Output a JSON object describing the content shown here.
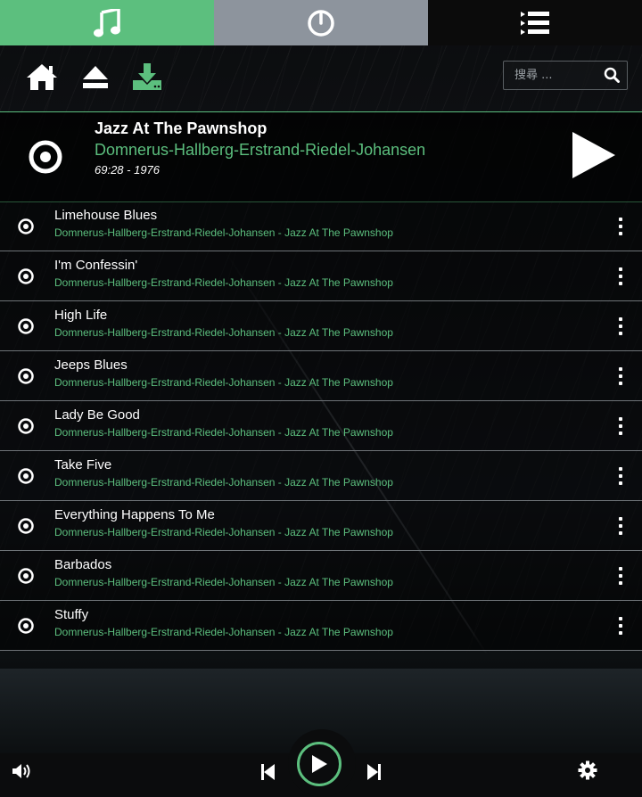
{
  "tabs": [
    {
      "name": "music-note-icon",
      "active": true
    },
    {
      "name": "clock-icon",
      "active": false
    },
    {
      "name": "playlist-icon",
      "active": false
    }
  ],
  "toolbar": {
    "home": "home-icon",
    "eject": "eject-icon",
    "download": "download-icon"
  },
  "search": {
    "placeholder": "搜尋 ..."
  },
  "album": {
    "title": "Jazz At The Pawnshop",
    "artist": "Domnerus-Hallberg-Erstrand-Riedel-Johansen",
    "meta": "69:28 - 1976"
  },
  "tracks": [
    {
      "title": "Limehouse Blues",
      "subtitle": "Domnerus-Hallberg-Erstrand-Riedel-Johansen - Jazz At The Pawnshop"
    },
    {
      "title": "I'm Confessin'",
      "subtitle": "Domnerus-Hallberg-Erstrand-Riedel-Johansen - Jazz At The Pawnshop"
    },
    {
      "title": "High Life",
      "subtitle": "Domnerus-Hallberg-Erstrand-Riedel-Johansen - Jazz At The Pawnshop"
    },
    {
      "title": "Jeeps Blues",
      "subtitle": "Domnerus-Hallberg-Erstrand-Riedel-Johansen - Jazz At The Pawnshop"
    },
    {
      "title": "Lady Be Good",
      "subtitle": "Domnerus-Hallberg-Erstrand-Riedel-Johansen - Jazz At The Pawnshop"
    },
    {
      "title": "Take Five",
      "subtitle": "Domnerus-Hallberg-Erstrand-Riedel-Johansen - Jazz At The Pawnshop"
    },
    {
      "title": "Everything Happens To Me",
      "subtitle": "Domnerus-Hallberg-Erstrand-Riedel-Johansen - Jazz At The Pawnshop"
    },
    {
      "title": "Barbados",
      "subtitle": "Domnerus-Hallberg-Erstrand-Riedel-Johansen - Jazz At The Pawnshop"
    },
    {
      "title": "Stuffy",
      "subtitle": "Domnerus-Hallberg-Erstrand-Riedel-Johansen - Jazz At The Pawnshop"
    }
  ],
  "colors": {
    "accent": "#5cbf7e",
    "tab_inactive": "#8d949d",
    "background": "#0b0c0e"
  }
}
